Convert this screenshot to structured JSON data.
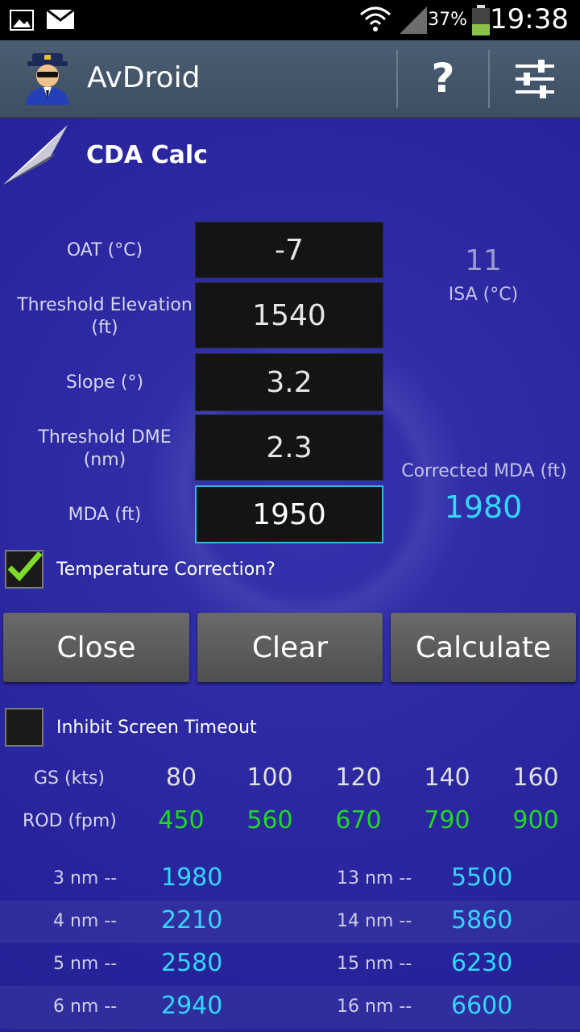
{
  "status": {
    "battery": "37%",
    "time": "19:38"
  },
  "app": {
    "title": "AvDroid"
  },
  "screen": {
    "title": "CDA Calc"
  },
  "inputs": {
    "oat_label": "OAT (°C)",
    "oat_value": "-7",
    "thr_elev_label_1": "Threshold Elevation",
    "thr_elev_label_2": "(ft)",
    "thr_elev_value": "1540",
    "slope_label": "Slope (°)",
    "slope_value": "3.2",
    "dme_label_1": "Threshold DME",
    "dme_label_2": "(nm)",
    "dme_value": "2.3",
    "mda_label": "MDA (ft)",
    "mda_value": "1950"
  },
  "isa": {
    "value": "11",
    "label": "ISA (°C)"
  },
  "corrected_mda": {
    "label": "Corrected MDA (ft)",
    "value": "1980"
  },
  "temp_correction": {
    "label": "Temperature Correction?",
    "checked": true
  },
  "buttons": {
    "close": "Close",
    "clear": "Clear",
    "calculate": "Calculate"
  },
  "inhibit": {
    "label": "Inhibit Screen Timeout",
    "checked": false
  },
  "speeds": {
    "gs_label": "GS (kts)",
    "rod_label": "ROD (fpm)",
    "gs": [
      "80",
      "100",
      "120",
      "140",
      "160"
    ],
    "rod": [
      "450",
      "560",
      "670",
      "790",
      "900"
    ]
  },
  "table": {
    "left": [
      {
        "nm": "3 nm --",
        "alt": "1980"
      },
      {
        "nm": "4 nm --",
        "alt": "2210"
      },
      {
        "nm": "5 nm --",
        "alt": "2580"
      },
      {
        "nm": "6 nm --",
        "alt": "2940"
      }
    ],
    "right": [
      {
        "nm": "13 nm --",
        "alt": "5500"
      },
      {
        "nm": "14 nm --",
        "alt": "5860"
      },
      {
        "nm": "15 nm --",
        "alt": "6230"
      },
      {
        "nm": "16 nm --",
        "alt": "6600"
      }
    ]
  }
}
